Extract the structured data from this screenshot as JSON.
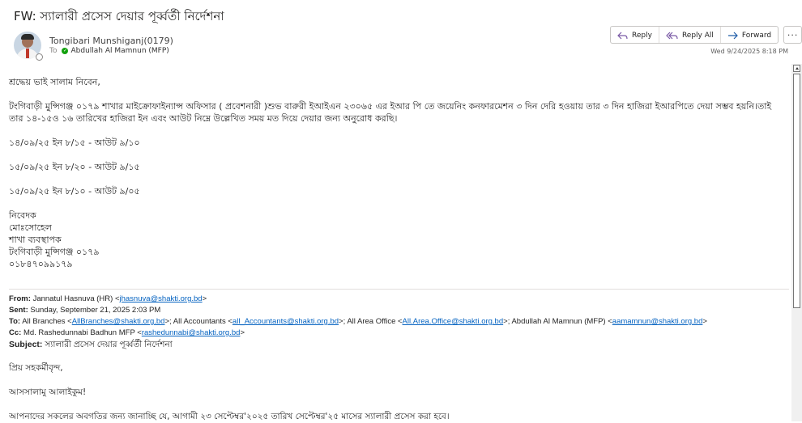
{
  "subject": "FW: স্যালারী প্রসেস দেয়ার পূর্ব্বর্তী নির্দেশনা",
  "header": {
    "sender": "Tongibari Munshiganj(0179)",
    "to_label": "To",
    "recipient": "Abdullah Al Mamnun (MFP)",
    "date": "Wed 9/24/2025 8:18 PM"
  },
  "actions": {
    "reply": "Reply",
    "reply_all": "Reply All",
    "forward": "Forward",
    "more": "···"
  },
  "body": {
    "greeting": "শ্রদ্ধেয় ভাই সালাম নিবেন,",
    "para1_line1": "টংগিবাড়ী মুন্সিগঞ্জ ০১৭৯ শাখার মাইক্রোফাইন্যান্স অফিসার ( প্রবেশনারী )শুভ বারুরী ইআইএন ২৩০৬৫ এর ইআর পি তে জয়েনিং কনফারমেশন ৩ দিন দেরি হওয়ায় তার ৩ দিন  হাজিরা ইআরপিতে দেয়া সম্ভব হয়নি।তাই",
    "para1_line2": "তার ১৪-১৫ও ১৬ তারিখের হাজিরা ইন এবং আউট নিম্নে উল্লেখিত সময় মত দিয়ে দেয়ার জন্য অনুরোধ করছি।",
    "time1": "১৪/০৯/২৫  ইন ৮/১৫ -  আউট ৯/১০",
    "time2": "১৫/০৯/২৫  ইন ৮/২০ -  আউট ৯/১৫",
    "time3": "১৫/০৯/২৫  ইন ৮/১০ -  আউট ৯/০৫",
    "sig1": "নিবেদক",
    "sig2": "মোঃসোহেল",
    "sig3": "শাখা ব্যবস্থাপক",
    "sig4": "টংগিবাড়ী মুন্সিগঞ্জ ০১৭৯",
    "sig5": "০১৮৪৭০৯৯১৭৯"
  },
  "forwarded": {
    "from_label": "From:",
    "from_name": "Jannatul Hasnuva (HR) <",
    "from_email": "jhasnuva@shakti.org.bd",
    "from_close": ">",
    "sent_label": "Sent:",
    "sent_value": "Sunday, September 21, 2025 2:03 PM",
    "to_label": "To:",
    "to_part1": "All Branches <",
    "to_email1": "AllBranches@shakti.org.bd",
    "to_part2": ">; All Accountants <",
    "to_email2": "all_Accountants@shakti.org.bd",
    "to_part3": ">; All Area Office <",
    "to_email3": "All.Area.Office@shakti.org.bd",
    "to_part4": ">; Abdullah Al Mamnun (MFP) <",
    "to_email4": "aamamnun@shakti.org.bd",
    "to_part5": ">",
    "cc_label": "Cc:",
    "cc_name": "Md. Rashedunnabi Badhun MFP <",
    "cc_email": "rashedunnabi@shakti.org.bd",
    "cc_close": ">",
    "subject_label": "Subject:",
    "subject_value": "স্যালারী প্রসেস দেয়ার পূর্ব্বর্তী নির্দেশনা",
    "greeting": "প্রিয় সহকর্মীবৃন্দ,",
    "salam": "আসসালামু আলাইকুম!",
    "cut_line": "আপনাদের সকলের অবগতির জন্য জানাচ্ছি যে, আগামী ২৩ সেপ্টেম্বর'২০২৫ তারিখ সেপ্টেম্বর'২৫ মাসের স্যালারী প্রসেস করা হবে।"
  }
}
